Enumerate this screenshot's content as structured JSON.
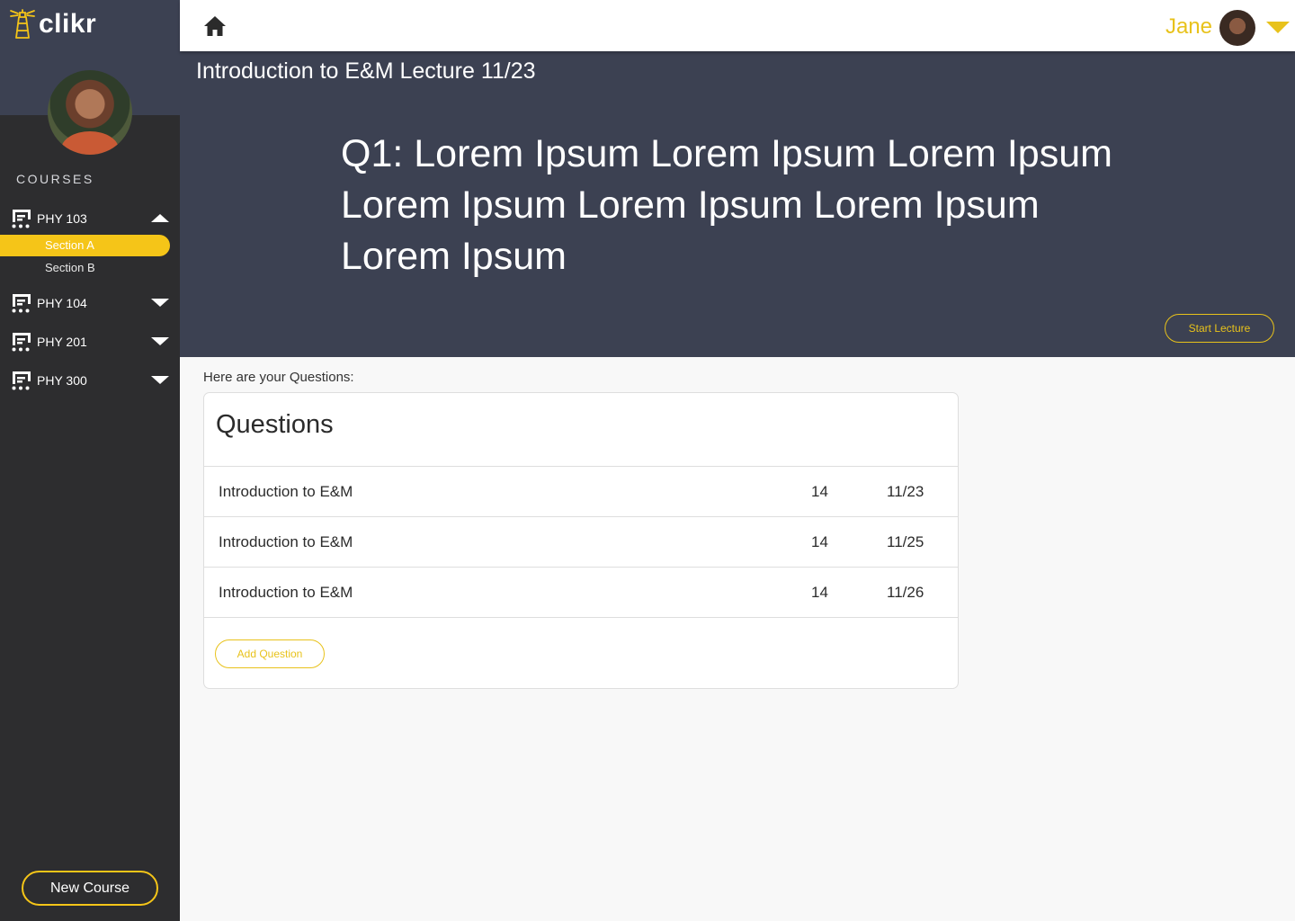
{
  "app": {
    "name": "clikr"
  },
  "sidebar": {
    "courses_heading": "COURSES",
    "courses": [
      {
        "label": "PHY 103",
        "expanded": true,
        "sections": [
          {
            "label": "Section A",
            "active": true
          },
          {
            "label": "Section B",
            "active": false
          }
        ]
      },
      {
        "label": "PHY 104",
        "expanded": false
      },
      {
        "label": "PHY 201",
        "expanded": false
      },
      {
        "label": "PHY 300",
        "expanded": false
      }
    ],
    "new_course_label": "New Course"
  },
  "topbar": {
    "user_name": "Jane",
    "icons": [
      "home-icon",
      "chevron-down-icon"
    ]
  },
  "hero": {
    "lecture_title": "Introduction to E&M Lecture 11/23",
    "question_text": "Q1: Lorem Ipsum Lorem Ipsum Lorem Ipsum Lorem Ipsum Lorem Ipsum Lorem Ipsum Lorem Ipsum",
    "start_label": "Start Lecture"
  },
  "main": {
    "intro": "Here are your Questions:",
    "card_title": "Questions",
    "rows": [
      {
        "name": "Introduction to E&M",
        "count": "14",
        "date": "11/23"
      },
      {
        "name": "Introduction to E&M",
        "count": "14",
        "date": "11/25"
      },
      {
        "name": "Introduction to E&M",
        "count": "14",
        "date": "11/26"
      }
    ],
    "add_label": "Add Question"
  },
  "colors": {
    "accent": "#f5c518",
    "sidebar": "#2d2d2f",
    "hero": "#3c4152",
    "background": "#f8f8f8"
  }
}
